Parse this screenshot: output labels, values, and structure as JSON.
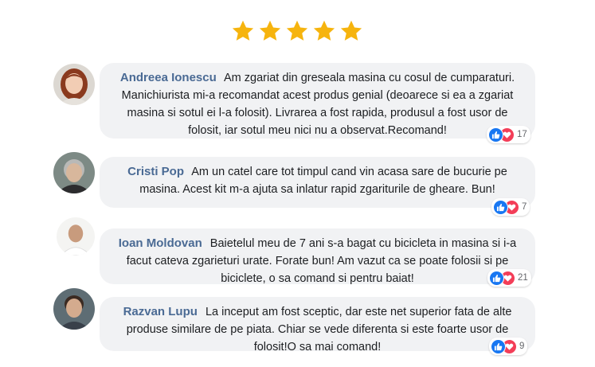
{
  "colors": {
    "star": "#f6b40e",
    "name": "#4a6a94",
    "bubble": "#f1f2f4",
    "like": "#1877f2",
    "love": "#f33e58"
  },
  "rating": {
    "stars": 5,
    "max": 5
  },
  "reviews": [
    {
      "name": "Andreea Ionescu",
      "text": "Am zgariat din greseala masina cu cosul de cumparaturi. Manichiurista mi-a recomandat acest produs genial (deoarece si ea a zgariat masina si sotul ei l-a folosit). Livrarea a fost  rapida, produsul a fost usor de folosit, iar sotul meu nici nu a observat.Recomand!",
      "reactions": "17",
      "avatar_icon": "avatar-woman-red-hair"
    },
    {
      "name": "Cristi Pop",
      "text": "Am un catel care  tot timpul cand vin  acasa sare de bucurie pe masina.  Acest kit m-a ajuta sa inlatur rapid zgariturile de gheare. Bun!",
      "reactions": "7",
      "avatar_icon": "avatar-man-grey-hair"
    },
    {
      "name": "Ioan Moldovan",
      "text": "Baietelul meu de 7 ani s-a bagat cu bicicleta in masina si i-a facut cateva zgarieturi urate. Forate bun! Am vazut ca se poate folosii si pe biciclete, o sa comand si pentru baiat!",
      "reactions": "21",
      "avatar_icon": "avatar-man-bald"
    },
    {
      "name": "Razvan Lupu",
      "text": "La inceput am fost sceptic, dar este net superior fata de  alte produse similare de pe piata. Chiar se vede diferenta si este foarte usor de folosit!O sa mai comand!",
      "reactions": "9",
      "avatar_icon": "avatar-man-dark-hair"
    }
  ]
}
